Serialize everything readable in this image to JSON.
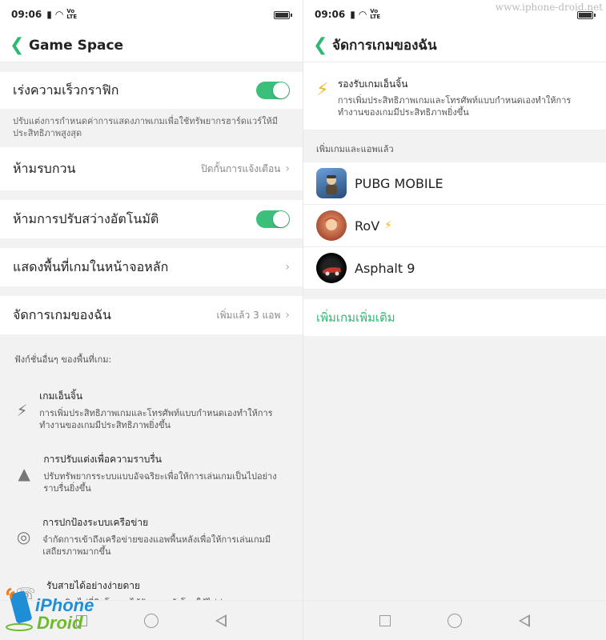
{
  "status": {
    "time": "09:06",
    "net": "Vo",
    "lte": "LTE"
  },
  "left": {
    "title": "Game Space",
    "graphics_accel": {
      "label": "เร่งความเร็วกราฟิก",
      "on": true,
      "desc": "ปรับแต่งการกำหนดค่าการแสดงภาพเกมเพื่อใช้ทรัพยากรฮาร์ดแวร์ให้มีประสิทธิภาพสูงสุด"
    },
    "dnd": {
      "label": "ห้ามรบกวน",
      "value": "ปิดกั้นการแจ้งเตือน"
    },
    "auto_brightness": {
      "label": "ห้ามการปรับสว่างอัตโนมัติ",
      "on": true
    },
    "home_screen": {
      "label": "แสดงพื้นที่เกมในหน้าจอหลัก"
    },
    "manage_games": {
      "label": "จัดการเกมของฉัน",
      "value": "เพิ่มแล้ว 3 แอพ"
    },
    "other_features_title": "ฟังก์ชั่นอื่นๆ ของพื้นที่เกม:",
    "features": [
      {
        "icon": "lightning-icon",
        "title": "เกมเอ็นจิ้น",
        "desc": "การเพิ่มประสิทธิภาพเกมและโทรศัพท์แบบกำหนดเองทำให้การทำงานของเกมมีประสิทธิภาพยิ่งขึ้น"
      },
      {
        "icon": "rocket-icon",
        "title": "การปรับแต่งเพื่อความราบรื่น",
        "desc": "ปรับทรัพยากรระบบแบบอัจฉริยะเพื่อให้การเล่นเกมเป็นไปอย่างราบรื่นยิ่งขึ้น"
      },
      {
        "icon": "globe-icon",
        "title": "การปกป้องระบบเครือข่าย",
        "desc": "จำกัดการเข้าถึงเครือข่ายของแอพพื้นหลังเพื่อให้การเล่นเกมมีเสถียรภาพมากขึ้น"
      },
      {
        "icon": "phone-icon",
        "title": "รับสายได้อย่างง่ายดาย",
        "desc": "การเชิญไปที่ดิสโดยจะได้รับการแจ้งโดยให้ไม่ประกาศ"
      }
    ]
  },
  "right": {
    "title": "จัดการเกมของฉัน",
    "boost": {
      "title": "รองรับเกมเอ็นจิ้น",
      "desc": "การเพิ่มประสิทธิภาพเกมและโทรศัพท์แบบกำหนดเองทำให้การทำงานของเกมมีประสิทธิภาพยิ่งขึ้น"
    },
    "added_title": "เพิ่มเกมและแอพแล้ว",
    "games": [
      {
        "name": "PUBG MOBILE",
        "boost": false
      },
      {
        "name": "RoV",
        "boost": true
      },
      {
        "name": "Asphalt 9",
        "boost": false
      }
    ],
    "add_more": "เพิ่มเกมเพิ่มเติม"
  },
  "watermark": "www.iphone-droid.net",
  "logo": {
    "line1": "iPhone",
    "line2": "Droid"
  },
  "colors": {
    "accent": "#2eb872",
    "toggle": "#3dbf7c",
    "bolt": "#f2b71c"
  }
}
